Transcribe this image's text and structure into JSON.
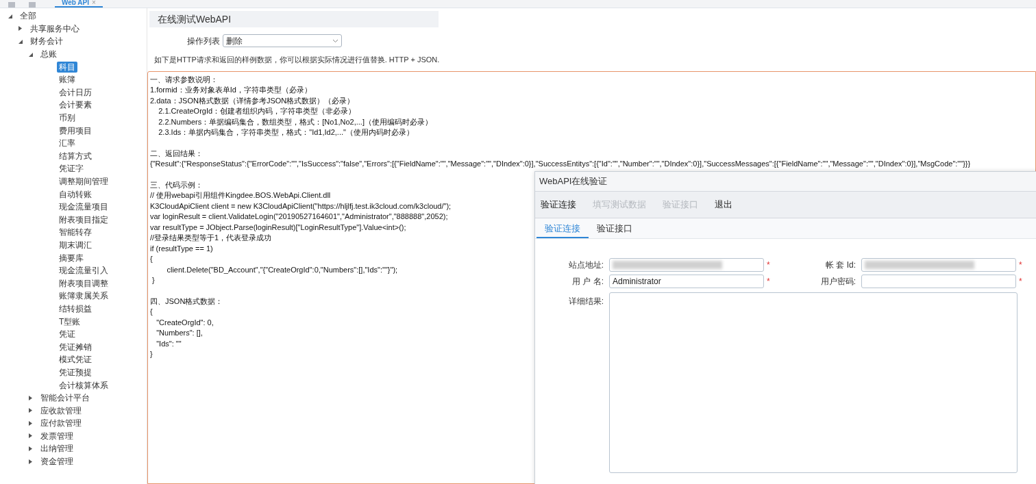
{
  "top_tab": {
    "label": "Web API",
    "close": "×"
  },
  "tree": [
    {
      "label": "全部",
      "expanded": true,
      "selected": false,
      "children": [
        {
          "label": "共享服务中心",
          "expanded": false,
          "selected": false
        },
        {
          "label": "财务会计",
          "expanded": true,
          "selected": false,
          "children": [
            {
              "label": "总账",
              "expanded": true,
              "selected": false,
              "children": [
                {
                  "label": "科目",
                  "selected": true
                },
                {
                  "label": "账簿",
                  "selected": false
                },
                {
                  "label": "会计日历",
                  "selected": false
                },
                {
                  "label": "会计要素",
                  "selected": false
                },
                {
                  "label": "币别",
                  "selected": false
                },
                {
                  "label": "费用项目",
                  "selected": false
                },
                {
                  "label": "汇率",
                  "selected": false
                },
                {
                  "label": "结算方式",
                  "selected": false
                },
                {
                  "label": "凭证字",
                  "selected": false
                },
                {
                  "label": "调整期间管理",
                  "selected": false
                },
                {
                  "label": "自动转账",
                  "selected": false
                },
                {
                  "label": "现金流量项目",
                  "selected": false
                },
                {
                  "label": "附表项目指定",
                  "selected": false
                },
                {
                  "label": "智能转存",
                  "selected": false
                },
                {
                  "label": "期末调汇",
                  "selected": false
                },
                {
                  "label": "摘要库",
                  "selected": false
                },
                {
                  "label": "现金流量引入",
                  "selected": false
                },
                {
                  "label": "附表项目调整",
                  "selected": false
                },
                {
                  "label": "账簿隶属关系",
                  "selected": false
                },
                {
                  "label": "结转损益",
                  "selected": false
                },
                {
                  "label": "T型账",
                  "selected": false
                },
                {
                  "label": "凭证",
                  "selected": false
                },
                {
                  "label": "凭证摊销",
                  "selected": false
                },
                {
                  "label": "模式凭证",
                  "selected": false
                },
                {
                  "label": "凭证预提",
                  "selected": false
                },
                {
                  "label": "会计核算体系",
                  "selected": false
                }
              ]
            },
            {
              "label": "智能会计平台",
              "expanded": false,
              "selected": false
            },
            {
              "label": "应收款管理",
              "expanded": false,
              "selected": false
            },
            {
              "label": "应付款管理",
              "expanded": false,
              "selected": false
            },
            {
              "label": "发票管理",
              "expanded": false,
              "selected": false
            },
            {
              "label": "出纳管理",
              "expanded": false,
              "selected": false
            },
            {
              "label": "资金管理",
              "expanded": false,
              "selected": false
            }
          ]
        }
      ]
    }
  ],
  "panel_title": "在线测试WebAPI",
  "operation": {
    "label": "操作列表",
    "value": "删除"
  },
  "hint": "如下是HTTP请求和返回的样例数据，你可以根据实际情况进行值替换. HTTP + JSON.",
  "sample_sections": [
    [
      "一、请求参数说明：",
      "1.formid：业务对象表单Id，字符串类型（必录）",
      "2.data：JSON格式数据（详情参考JSON格式数据）（必录）",
      "    2.1.CreateOrgId：创建者组织内码，字符串类型（非必录）",
      "    2.2.Numbers：单据编码集合，数组类型，格式：[No1,No2,...]（使用编码时必录）",
      "    2.3.Ids：单据内码集合，字符串类型，格式：\"Id1,Id2,...\"（使用内码时必录）"
    ],
    [
      "二、返回结果：",
      "{\"Result\":{\"ResponseStatus\":{\"ErrorCode\":\"\",\"IsSuccess\":\"false\",\"Errors\":[{\"FieldName\":\"\",\"Message\":\"\",\"DIndex\":0}],\"SuccessEntitys\":[{\"Id\":\"\",\"Number\":\"\",\"DIndex\":0}],\"SuccessMessages\":[{\"FieldName\":\"\",\"Message\":\"\",\"DIndex\":0}],\"MsgCode\":\"\"}}}"
    ],
    [
      "三、代码示例：",
      "// 使用webapi引用组件Kingdee.BOS.WebApi.Client.dll",
      "K3CloudApiClient client = new K3CloudApiClient(\"https://hljlfj.test.ik3cloud.com/k3cloud/\");",
      "var loginResult = client.ValidateLogin(\"20190527164601\",\"Administrator\",\"888888\",2052);",
      "var resultType = JObject.Parse(loginResult)[\"LoginResultType\"].Value<int>();",
      "//登录结果类型等于1，代表登录成功",
      "if (resultType == 1)",
      "{",
      "        client.Delete(\"BD_Account\",\"{\"CreateOrgId\":0,\"Numbers\":[],\"Ids\":\"\"}\");",
      " }"
    ],
    [
      "四、JSON格式数据：",
      "{",
      "   \"CreateOrgId\": 0,",
      "   \"Numbers\": [],",
      "   \"Ids\": \"\"",
      "}"
    ]
  ],
  "dialog": {
    "title": "WebAPI在线验证",
    "toolbar": [
      {
        "label": "验证连接",
        "disabled": false
      },
      {
        "label": "填写测试数据",
        "disabled": true
      },
      {
        "label": "验证接口",
        "disabled": true
      },
      {
        "label": "退出",
        "disabled": false
      }
    ],
    "tabs": [
      {
        "label": "验证连接",
        "selected": true
      },
      {
        "label": "验证接口",
        "selected": false
      }
    ],
    "fields": [
      {
        "label": "站点地址:",
        "blurred": true,
        "required": true
      },
      {
        "label": "帐 套 Id:",
        "blurred": true,
        "required": true
      },
      {
        "label": "用 户 名:",
        "value": "Administrator",
        "blurred": false,
        "required": true
      },
      {
        "label": "用户密码:",
        "blurred": false,
        "required": true
      }
    ],
    "required_mark": "*",
    "result_label": "详细结果:"
  }
}
